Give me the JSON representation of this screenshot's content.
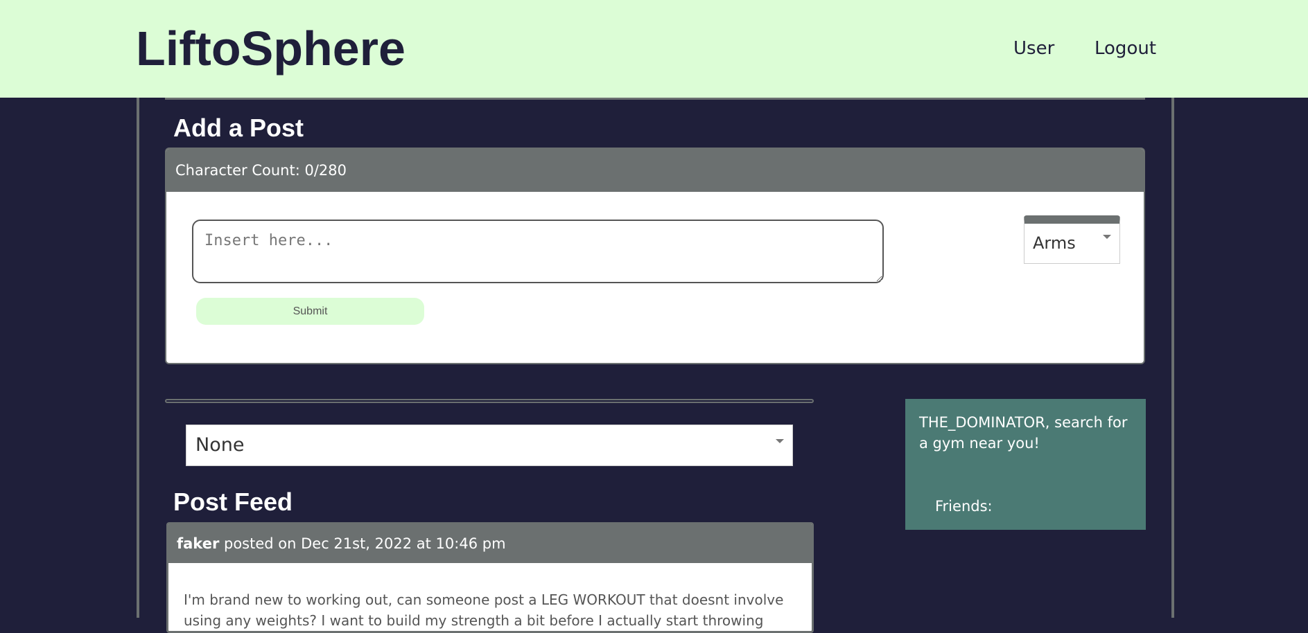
{
  "header": {
    "brand": "LiftoSphere",
    "nav": {
      "user": "User",
      "logout": "Logout"
    }
  },
  "add_post": {
    "title": "Add a Post",
    "char_count": "Character Count: 0/280",
    "textarea_placeholder": "Insert here...",
    "submit_label": "Submit",
    "category_selected": "Arms"
  },
  "feed": {
    "filter_selected": "None",
    "title": "Post Feed",
    "posts": [
      {
        "author": "faker",
        "meta": " posted on Dec 21st, 2022 at 10:46 pm",
        "body": "I'm brand new to working out, can someone post a LEG WORKOUT that doesnt involve using any weights? I want to build my strength a bit before I actually start throwing"
      }
    ]
  },
  "sidebar": {
    "prompt": "THE_DOMINATOR, search for a gym near you!",
    "friends_label": "Friends:"
  },
  "colors": {
    "background": "#1f1f3a",
    "header": "#dcfdd6",
    "card_header": "#6b7070",
    "side_panel": "#4b7a74"
  }
}
